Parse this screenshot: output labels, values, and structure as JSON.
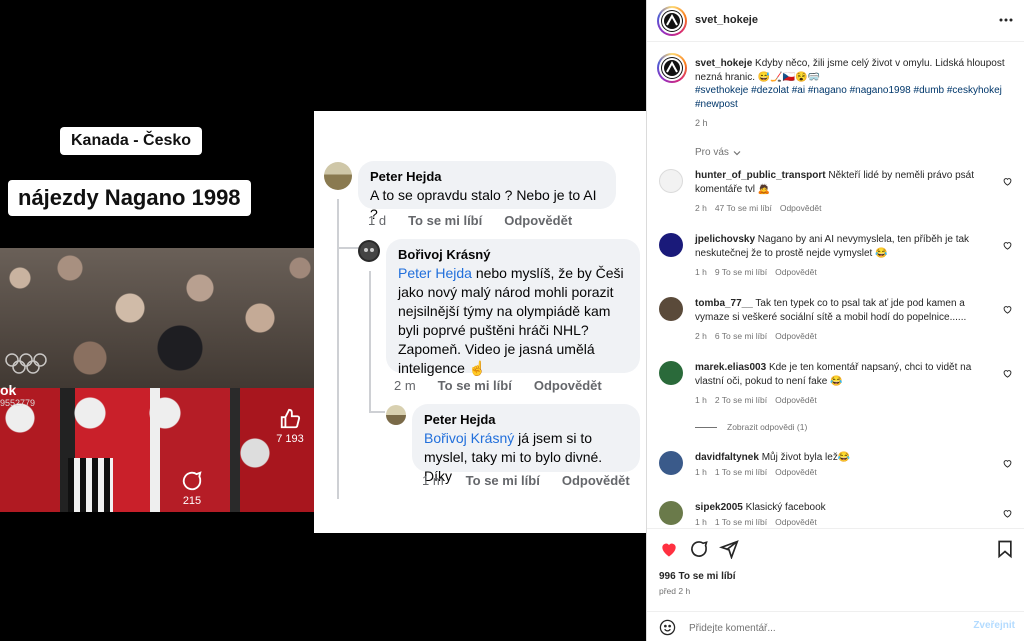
{
  "media": {
    "video_label_country": "Kanada - Česko",
    "video_label_title": "nájezdy Nagano 1998",
    "watermark": "ok",
    "watermark_sub": "9552779",
    "like_count": "7 193",
    "comment_count": "215"
  },
  "fb_comments": [
    {
      "name": "Peter Hejda",
      "text": "A to se opravdu stalo ? Nebo je to AI ?",
      "time": "1 d",
      "like": "To se mi líbí",
      "reply": "Odpovědět"
    },
    {
      "name": "Bořivoj Krásný",
      "mention": "Peter Hejda",
      "text": " nebo myslíš, že by Češi jako nový malý národ mohli porazit nejsilnější týmy na olympiádě kam byli poprvé puštěni hráči NHL? Zapomeň. Video je jasná umělá inteligence ☝",
      "time": "2 m",
      "like": "To se mi líbí",
      "reply": "Odpovědět"
    },
    {
      "name": "Peter Hejda",
      "mention": "Bořivoj Krásný",
      "text": " já jsem si to myslel, taky mi to bylo divné. Díky",
      "time": "1 m",
      "like": "To se mi líbí",
      "reply": "Odpovědět"
    }
  ],
  "post": {
    "username": "svet_hokeje",
    "caption_text": " Kdyby něco, žili jsme celý život v omylu. Lidská hloupost nezná hranic. 😅🏒🇨🇿😵🥽",
    "hashtags": "#svethokeje #dezolat #ai #nagano #nagano1998 #dumb #ceskyhokej #newpost",
    "time": "2 h",
    "for_you": "Pro vás",
    "likes": "996 To se mi líbí",
    "posted": "před 2 h",
    "comment_placeholder": "Přidejte komentář...",
    "publish": "Zveřejnit"
  },
  "comments": [
    {
      "user": "hunter_of_public_transport",
      "text": " Někteří lidé by neměli právo psát komentáře tvl 🙇",
      "time": "2 h",
      "likes": "47 To se mi líbí",
      "reply": "Odpovědět",
      "avatar_color": "#f2f2f2"
    },
    {
      "user": "jpelichovsky",
      "text": " Nagano by ani AI nevymyslela, ten příběh je tak neskutečnej že to prostě nejde vymyslet 😂",
      "time": "1 h",
      "likes": "9 To se mi líbí",
      "reply": "Odpovědět",
      "avatar_color": "#1a1a7a"
    },
    {
      "user": "tomba_77__",
      "text": " Tak ten typek co to psal tak ať jde pod kamen a vymaze si veškeré sociální sítě a mobil hodí do popelnice......",
      "time": "2 h",
      "likes": "6 To se mi líbí",
      "reply": "Odpovědět",
      "avatar_color": "#5a4a3a"
    },
    {
      "user": "marek.elias003",
      "text": " Kde je ten komentář napsaný, chci to vidět na vlastní oči, pokud to není fake 😂",
      "time": "1 h",
      "likes": "2 To se mi líbí",
      "reply": "Odpovědět",
      "avatar_color": "#2a6a3a",
      "show_replies": "Zobrazit odpovědi (1)"
    },
    {
      "user": "davidfaltynek",
      "text": " Můj život byla lež😂",
      "time": "1 h",
      "likes": "1 To se mi líbí",
      "reply": "Odpovědět",
      "avatar_color": "#3a5a8a"
    },
    {
      "user": "sipek2005",
      "text": " Klasický facebook",
      "time": "1 h",
      "likes": "1 To se mi líbí",
      "reply": "Odpovědět",
      "avatar_color": "#6a7a4a"
    }
  ]
}
